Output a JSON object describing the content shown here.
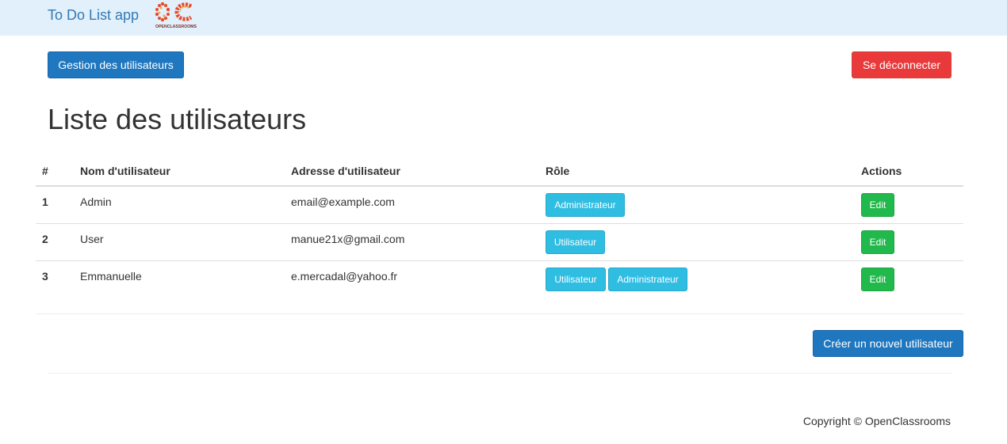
{
  "header": {
    "brand": "To Do List app",
    "logo_text": "OPENCLASSROOMS",
    "logo_colors": [
      "#e94b2e",
      "#f2a22c",
      "#7a2f2f"
    ]
  },
  "toolbar": {
    "manage_users_label": "Gestion des utilisateurs",
    "logout_label": "Se déconnecter"
  },
  "page": {
    "title": "Liste des utilisateurs"
  },
  "table": {
    "columns": [
      "#",
      "Nom d'utilisateur",
      "Adresse d'utilisateur",
      "Rôle",
      "Actions"
    ],
    "rows": [
      {
        "id": "1",
        "username": "Admin",
        "email": "email@example.com",
        "roles": [
          "Administrateur"
        ],
        "action": "Edit"
      },
      {
        "id": "2",
        "username": "User",
        "email": "manue21x@gmail.com",
        "roles": [
          "Utilisateur"
        ],
        "action": "Edit"
      },
      {
        "id": "3",
        "username": "Emmanuelle",
        "email": "e.mercadal@yahoo.fr",
        "roles": [
          "Utilisateur",
          "Administrateur"
        ],
        "action": "Edit"
      }
    ]
  },
  "actions": {
    "create_user_label": "Créer un nouvel utilisateur"
  },
  "footer": {
    "copyright": "Copyright © OpenClassrooms"
  },
  "colors": {
    "primary": "#1f77bf",
    "danger": "#e9393a",
    "info": "#2fbde2",
    "success": "#22b94c",
    "navbar_bg": "#e1f0fa",
    "brand_link": "#337ab7"
  }
}
